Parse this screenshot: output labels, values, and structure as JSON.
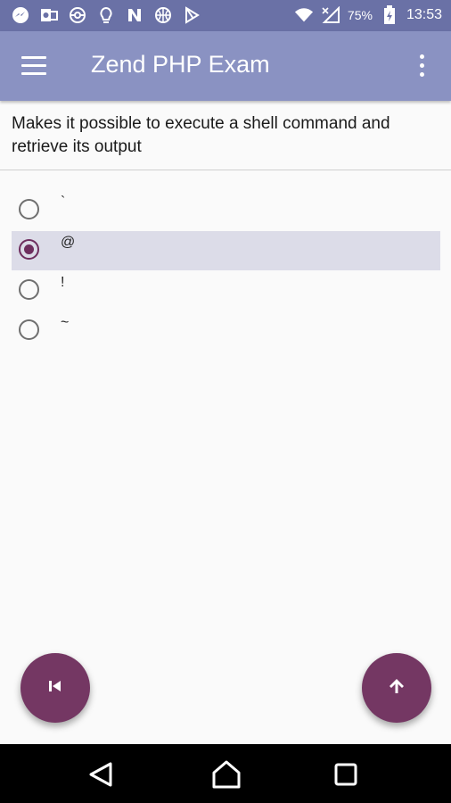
{
  "status_bar": {
    "notification_icons": [
      "messenger-icon",
      "outlook-icon",
      "pokeball-icon",
      "lightbulb-icon",
      "n-app-icon",
      "basketball-icon",
      "play-store-icon"
    ],
    "system_icons": [
      "wifi-icon",
      "signal-icon",
      "battery-icon"
    ],
    "battery_percent": "75%",
    "time": "13:53"
  },
  "app_bar": {
    "title": "Zend PHP Exam",
    "menu_icon": "menu-icon",
    "overflow_icon": "more-vert-icon"
  },
  "question": {
    "text": "Makes it possible to execute a shell command and retrieve its output"
  },
  "options": [
    {
      "label": "`",
      "selected": false
    },
    {
      "label": "@",
      "selected": true
    },
    {
      "label": "!",
      "selected": false
    },
    {
      "label": "~",
      "selected": false
    }
  ],
  "fabs": {
    "previous_icon": "skip-previous-icon",
    "submit_icon": "arrow-up-icon"
  },
  "colors": {
    "status_bar": "#6a71a6",
    "app_bar": "#8a92c2",
    "accent": "#743763",
    "selected_row": "#dcdce8"
  }
}
